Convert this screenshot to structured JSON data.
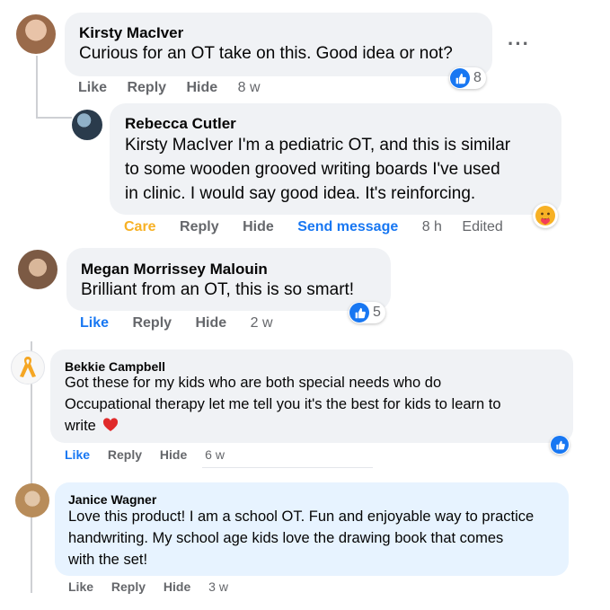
{
  "comments": [
    {
      "author": "Kirsty MacIver",
      "text": "Curious for an OT take on this. Good idea or not?",
      "actions": {
        "like": "Like",
        "reply": "Reply",
        "hide": "Hide"
      },
      "time": "8 w",
      "reactions": {
        "icon": "like-icon",
        "count": "8"
      },
      "more": "···"
    },
    {
      "author": "Rebecca Cutler",
      "text_lines": [
        "Kirsty MacIver I'm a pediatric OT, and this is similar",
        "to some wooden grooved writing boards I've used",
        "in clinic. I would say good idea. It's reinforcing."
      ],
      "actions": {
        "reaction": "Care",
        "reply": "Reply",
        "hide": "Hide",
        "message": "Send message"
      },
      "time": "8 h",
      "edited": "Edited",
      "reactions": {
        "icon": "care-emoji-icon"
      }
    },
    {
      "author": "Megan Morrissey Malouin",
      "text": "Brilliant from an OT, this is so smart!",
      "actions": {
        "like": "Like",
        "reply": "Reply",
        "hide": "Hide"
      },
      "time": "2 w",
      "reactions": {
        "icon": "like-icon",
        "count": "5"
      }
    },
    {
      "author": "Bekkie Campbell",
      "text_lines": [
        "Got these for my kids who are both special needs who do",
        "Occupational therapy let me tell you it's the best for kids to learn to",
        "write"
      ],
      "actions": {
        "like": "Like",
        "reply": "Reply",
        "hide": "Hide"
      },
      "time": "6 w",
      "reactions": {
        "icon": "like-icon"
      }
    },
    {
      "author": "Janice Wagner",
      "text_lines": [
        "Love this product! I am a school OT. Fun and enjoyable way to practice",
        "handwriting. My school age kids love the drawing book that comes",
        "with the set!"
      ],
      "actions": {
        "like": "Like",
        "reply": "Reply",
        "hide": "Hide"
      },
      "time": "3 w"
    }
  ],
  "colors": {
    "accent": "#1877f2",
    "care": "#f7b125",
    "muted": "#65676b",
    "bubble": "#f0f2f5",
    "bubble_blue": "#e7f3ff"
  }
}
